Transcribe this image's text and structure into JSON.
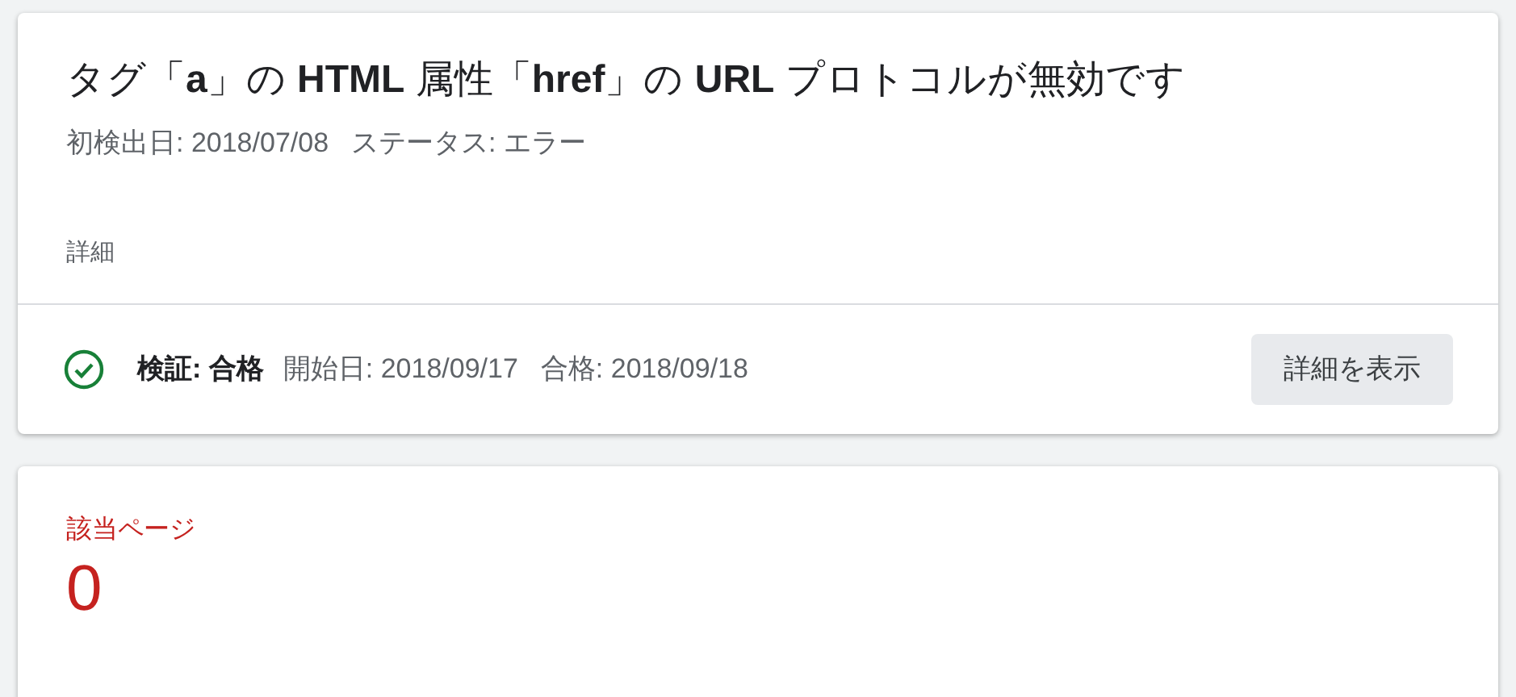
{
  "issue": {
    "title": "タグ「**a**」の **HTML** 属性「**href**」の **URL** プロトコルが無効です",
    "first_detected": "初検出日: 2018/07/08",
    "status": "ステータス: エラー",
    "details_label": "詳細"
  },
  "validation": {
    "label": "検証: 合格",
    "start_date": "開始日: 2018/09/17",
    "passed_date": "合格: 2018/09/18",
    "button": "詳細を表示"
  },
  "affected_pages": {
    "label": "該当ページ",
    "count": "0"
  }
}
